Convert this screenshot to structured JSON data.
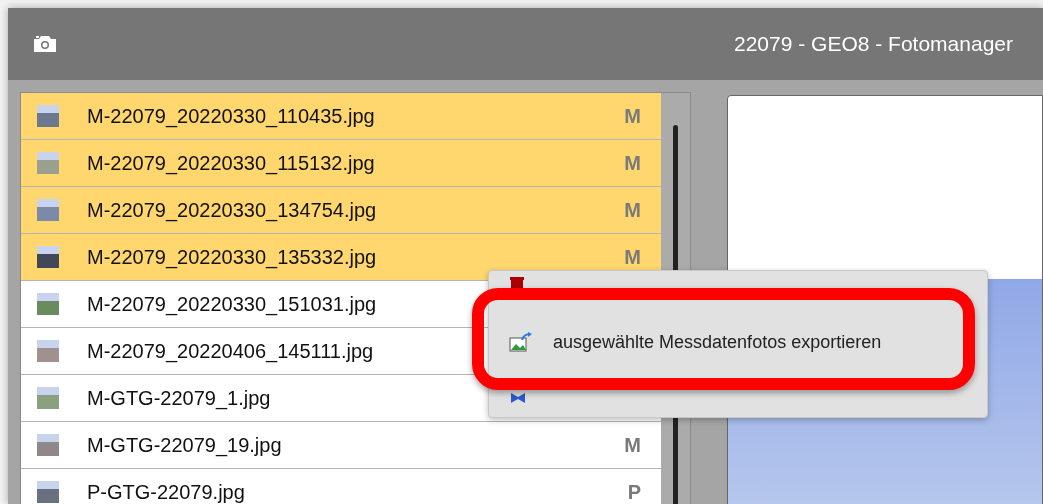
{
  "window": {
    "title": "22079 - GEO8 - Fotomanager"
  },
  "files": [
    {
      "name": "M-22079_20220330_110435.jpg",
      "badge": "M",
      "selected": true
    },
    {
      "name": "M-22079_20220330_115132.jpg",
      "badge": "M",
      "selected": true
    },
    {
      "name": "M-22079_20220330_134754.jpg",
      "badge": "M",
      "selected": true
    },
    {
      "name": "M-22079_20220330_135332.jpg",
      "badge": "M",
      "selected": true
    },
    {
      "name": "M-22079_20220330_151031.jpg",
      "selected": false
    },
    {
      "name": "M-22079_20220406_145111.jpg",
      "selected": false
    },
    {
      "name": "M-GTG-22079_1.jpg",
      "selected": false
    },
    {
      "name": "M-GTG-22079_19.jpg",
      "badge": "M",
      "selected": false
    },
    {
      "name": "P-GTG-22079.jpg",
      "badge": "P",
      "selected": false
    }
  ],
  "context_menu": {
    "items": [
      {
        "kind": "delete"
      },
      {
        "kind": "export",
        "label": "ausgewählte Messdatenfotos exportieren",
        "highlighted": true
      },
      {
        "kind": "coordinates"
      }
    ]
  }
}
